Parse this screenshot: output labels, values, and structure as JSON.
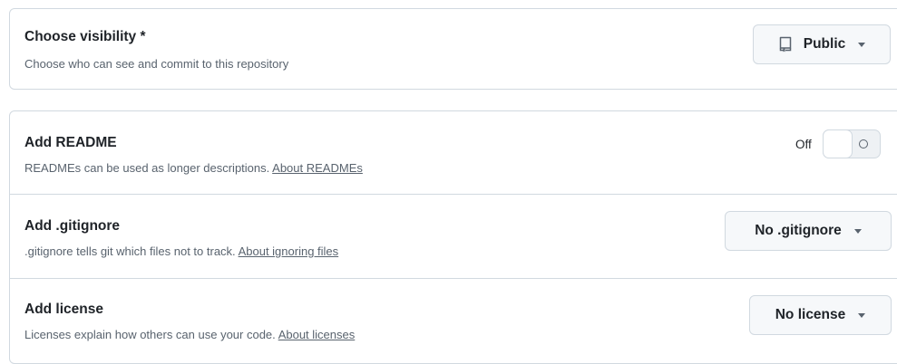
{
  "visibility": {
    "title": "Choose visibility *",
    "description": "Choose who can see and commit to this repository",
    "button_label": "Public",
    "button_icon": "repo-icon"
  },
  "readme": {
    "title": "Add README",
    "description": "READMEs can be used as longer descriptions.",
    "link": "About READMEs",
    "toggle_label": "Off",
    "toggle_state": "off"
  },
  "gitignore": {
    "title": "Add .gitignore",
    "description": ".gitignore tells git which files not to track.",
    "link": "About ignoring files",
    "button_label": "No .gitignore"
  },
  "license": {
    "title": "Add license",
    "description": "Licenses explain how others can use your code.",
    "link": "About licenses",
    "button_label": "No license"
  }
}
